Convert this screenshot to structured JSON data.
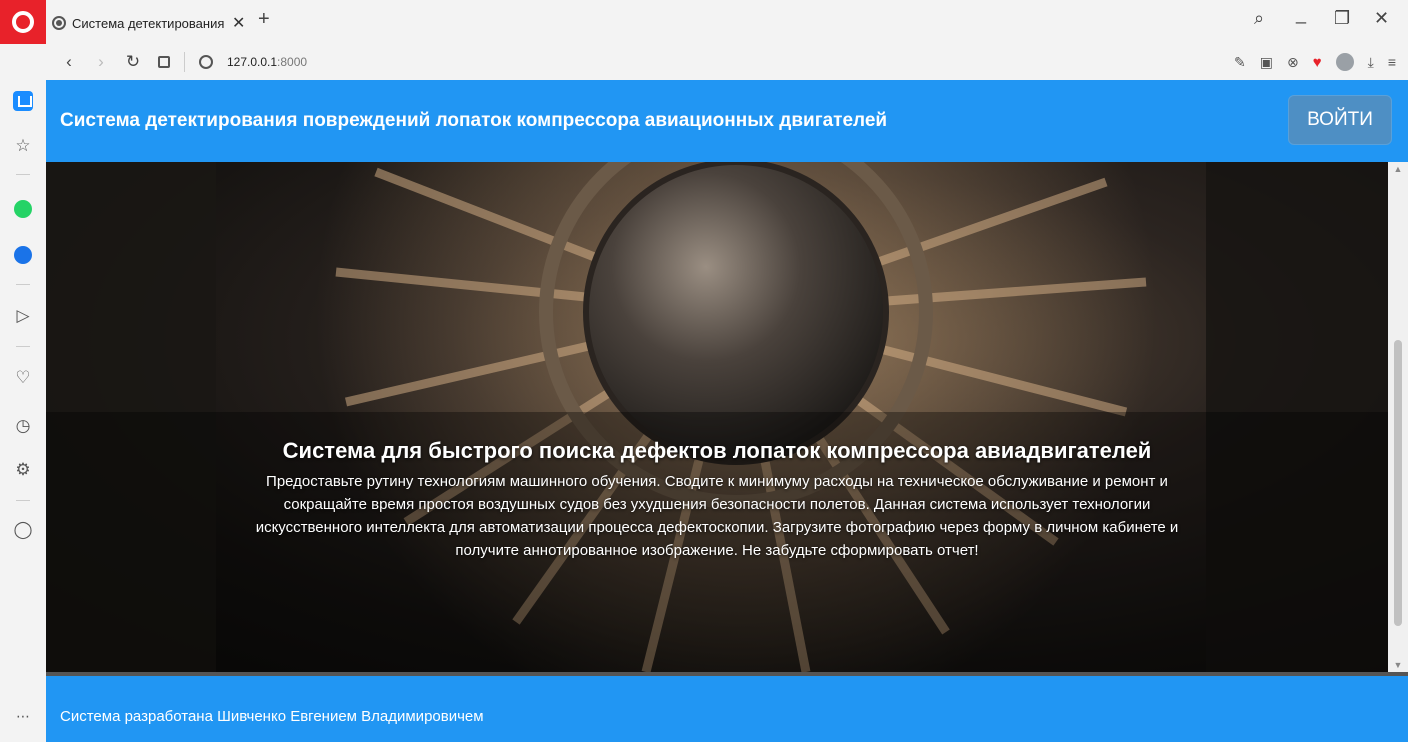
{
  "browser": {
    "tab_title": "Система детектирования",
    "tab_close": "✕",
    "new_tab": "+",
    "url_host": "127.0.0.1",
    "url_port": ":8000",
    "window_controls": {
      "search": "⌕",
      "minimize": "_",
      "restore": "❐",
      "close": "✕"
    }
  },
  "site": {
    "header_title": "Система детектирования повреждений лопаток компрессора авиационных двигателей",
    "login_label": "ВОЙТИ",
    "hero_title": "Система для быстрого поиска дефектов лопаток компрессора авиадвигателей",
    "hero_text": "Предоставьте рутину технологиям машинного обучения. Сводите к минимуму расходы на техническое обслуживание и ремонт и сокращайте время простоя воздушных судов без ухудшения безопасности полетов. Данная система использует технологии искусственного интеллекта для автоматизации процесса дефектоскопии. Загрузите фотографию через форму в личном кабинете и получите аннотированное изображение. Не забудьте сформировать отчет!",
    "footer_text": "Система разработана Шивченко Евгением Владимировичем"
  },
  "colors": {
    "brand_blue": "#2196f3",
    "opera_red": "#e8222a",
    "login_button": "#4e8fc4"
  }
}
